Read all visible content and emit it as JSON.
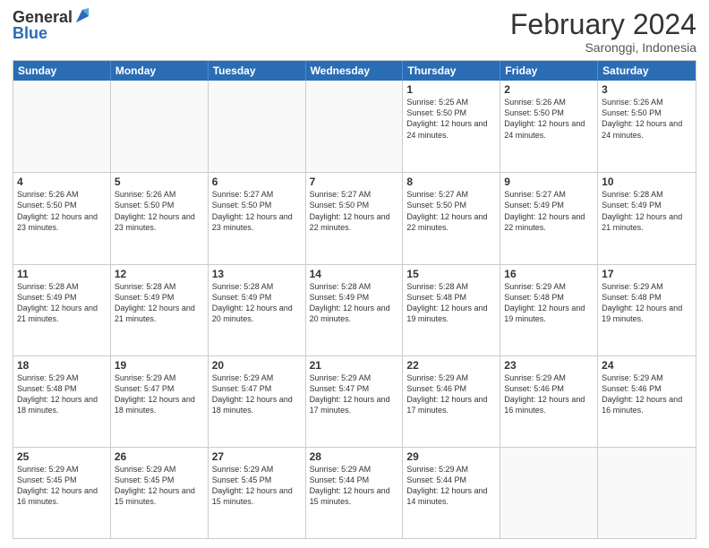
{
  "header": {
    "logo_general": "General",
    "logo_blue": "Blue",
    "month_title": "February 2024",
    "subtitle": "Saronggi, Indonesia"
  },
  "days_of_week": [
    "Sunday",
    "Monday",
    "Tuesday",
    "Wednesday",
    "Thursday",
    "Friday",
    "Saturday"
  ],
  "weeks": [
    [
      {
        "day": "",
        "info": "",
        "empty": true
      },
      {
        "day": "",
        "info": "",
        "empty": true
      },
      {
        "day": "",
        "info": "",
        "empty": true
      },
      {
        "day": "",
        "info": "",
        "empty": true
      },
      {
        "day": "1",
        "info": "Sunrise: 5:25 AM\nSunset: 5:50 PM\nDaylight: 12 hours and 24 minutes.",
        "empty": false
      },
      {
        "day": "2",
        "info": "Sunrise: 5:26 AM\nSunset: 5:50 PM\nDaylight: 12 hours and 24 minutes.",
        "empty": false
      },
      {
        "day": "3",
        "info": "Sunrise: 5:26 AM\nSunset: 5:50 PM\nDaylight: 12 hours and 24 minutes.",
        "empty": false
      }
    ],
    [
      {
        "day": "4",
        "info": "Sunrise: 5:26 AM\nSunset: 5:50 PM\nDaylight: 12 hours and 23 minutes.",
        "empty": false
      },
      {
        "day": "5",
        "info": "Sunrise: 5:26 AM\nSunset: 5:50 PM\nDaylight: 12 hours and 23 minutes.",
        "empty": false
      },
      {
        "day": "6",
        "info": "Sunrise: 5:27 AM\nSunset: 5:50 PM\nDaylight: 12 hours and 23 minutes.",
        "empty": false
      },
      {
        "day": "7",
        "info": "Sunrise: 5:27 AM\nSunset: 5:50 PM\nDaylight: 12 hours and 22 minutes.",
        "empty": false
      },
      {
        "day": "8",
        "info": "Sunrise: 5:27 AM\nSunset: 5:50 PM\nDaylight: 12 hours and 22 minutes.",
        "empty": false
      },
      {
        "day": "9",
        "info": "Sunrise: 5:27 AM\nSunset: 5:49 PM\nDaylight: 12 hours and 22 minutes.",
        "empty": false
      },
      {
        "day": "10",
        "info": "Sunrise: 5:28 AM\nSunset: 5:49 PM\nDaylight: 12 hours and 21 minutes.",
        "empty": false
      }
    ],
    [
      {
        "day": "11",
        "info": "Sunrise: 5:28 AM\nSunset: 5:49 PM\nDaylight: 12 hours and 21 minutes.",
        "empty": false
      },
      {
        "day": "12",
        "info": "Sunrise: 5:28 AM\nSunset: 5:49 PM\nDaylight: 12 hours and 21 minutes.",
        "empty": false
      },
      {
        "day": "13",
        "info": "Sunrise: 5:28 AM\nSunset: 5:49 PM\nDaylight: 12 hours and 20 minutes.",
        "empty": false
      },
      {
        "day": "14",
        "info": "Sunrise: 5:28 AM\nSunset: 5:49 PM\nDaylight: 12 hours and 20 minutes.",
        "empty": false
      },
      {
        "day": "15",
        "info": "Sunrise: 5:28 AM\nSunset: 5:48 PM\nDaylight: 12 hours and 19 minutes.",
        "empty": false
      },
      {
        "day": "16",
        "info": "Sunrise: 5:29 AM\nSunset: 5:48 PM\nDaylight: 12 hours and 19 minutes.",
        "empty": false
      },
      {
        "day": "17",
        "info": "Sunrise: 5:29 AM\nSunset: 5:48 PM\nDaylight: 12 hours and 19 minutes.",
        "empty": false
      }
    ],
    [
      {
        "day": "18",
        "info": "Sunrise: 5:29 AM\nSunset: 5:48 PM\nDaylight: 12 hours and 18 minutes.",
        "empty": false
      },
      {
        "day": "19",
        "info": "Sunrise: 5:29 AM\nSunset: 5:47 PM\nDaylight: 12 hours and 18 minutes.",
        "empty": false
      },
      {
        "day": "20",
        "info": "Sunrise: 5:29 AM\nSunset: 5:47 PM\nDaylight: 12 hours and 18 minutes.",
        "empty": false
      },
      {
        "day": "21",
        "info": "Sunrise: 5:29 AM\nSunset: 5:47 PM\nDaylight: 12 hours and 17 minutes.",
        "empty": false
      },
      {
        "day": "22",
        "info": "Sunrise: 5:29 AM\nSunset: 5:46 PM\nDaylight: 12 hours and 17 minutes.",
        "empty": false
      },
      {
        "day": "23",
        "info": "Sunrise: 5:29 AM\nSunset: 5:46 PM\nDaylight: 12 hours and 16 minutes.",
        "empty": false
      },
      {
        "day": "24",
        "info": "Sunrise: 5:29 AM\nSunset: 5:46 PM\nDaylight: 12 hours and 16 minutes.",
        "empty": false
      }
    ],
    [
      {
        "day": "25",
        "info": "Sunrise: 5:29 AM\nSunset: 5:45 PM\nDaylight: 12 hours and 16 minutes.",
        "empty": false
      },
      {
        "day": "26",
        "info": "Sunrise: 5:29 AM\nSunset: 5:45 PM\nDaylight: 12 hours and 15 minutes.",
        "empty": false
      },
      {
        "day": "27",
        "info": "Sunrise: 5:29 AM\nSunset: 5:45 PM\nDaylight: 12 hours and 15 minutes.",
        "empty": false
      },
      {
        "day": "28",
        "info": "Sunrise: 5:29 AM\nSunset: 5:44 PM\nDaylight: 12 hours and 15 minutes.",
        "empty": false
      },
      {
        "day": "29",
        "info": "Sunrise: 5:29 AM\nSunset: 5:44 PM\nDaylight: 12 hours and 14 minutes.",
        "empty": false
      },
      {
        "day": "",
        "info": "",
        "empty": true
      },
      {
        "day": "",
        "info": "",
        "empty": true
      }
    ]
  ]
}
